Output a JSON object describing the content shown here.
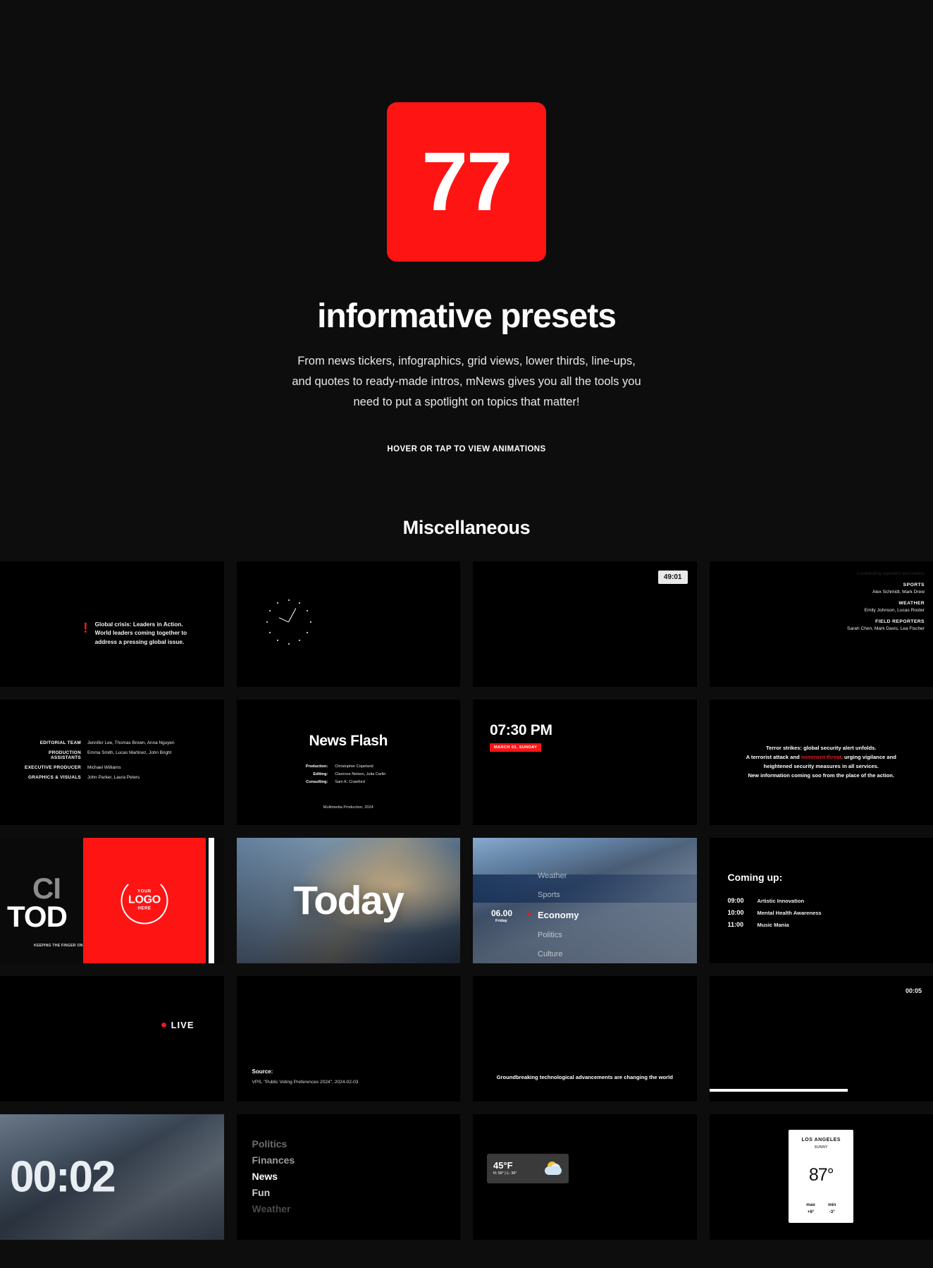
{
  "hero": {
    "badge_number": "77",
    "title": "informative presets",
    "description": "From news tickers, infographics, grid views, lower thirds, line-ups, and quotes to ready-made intros, mNews gives you all the tools you need to put a spotlight on topics that matter!",
    "hint": "HOVER OR TAP TO VIEW ANIMATIONS",
    "accent_color": "#ff1414",
    "background_color": "#0d0d0d"
  },
  "section": {
    "title": "Miscellaneous"
  },
  "tiles": {
    "alert_ticker": {
      "icon": "!",
      "line1": "Global crisis: Leaders in Action.",
      "line2": "World leaders coming together to",
      "line3": "address a pressing global issue."
    },
    "clock": {
      "name": "analog-clock"
    },
    "timer_chip": {
      "value": "49:01"
    },
    "credits_roll": {
      "groups": [
        {
          "role": "SPORTS",
          "names": "Alex Schmidt, Mark Drew"
        },
        {
          "role": "WEATHER",
          "names": "Emily Johnson, Lucas Roster"
        },
        {
          "role": "FIELD REPORTERS",
          "names": "Sarah Chen, Mark Davis, Lea Fischer"
        }
      ]
    },
    "editorial_team": {
      "rows": [
        {
          "role": "EDITORIAL TEAM",
          "names": "Jennifer Lee, Thomas Brown, Anna Nguyen"
        },
        {
          "role": "PRODUCTION ASSISTANTS",
          "names": "Emma Smith, Lucas Martinez, John Bright"
        },
        {
          "role": "EXECUTIVE PRODUCER",
          "names": "Michael Williams"
        },
        {
          "role": "GRAPHICS & VISUALS",
          "names": "John Parker, Laura Peters"
        }
      ]
    },
    "news_flash": {
      "title": "News Flash",
      "rows": [
        {
          "key": "Production:",
          "value": "Christopher Copeland"
        },
        {
          "key": "Editing:",
          "value": "Clarence Nelson, Julia Carlin"
        },
        {
          "key": "Consulting:",
          "value": "Sam K. Crawford"
        }
      ],
      "footer": "Multimedia Production, 2024"
    },
    "time_card": {
      "time": "07:30 PM",
      "date": "MARCH 03, SUNDAY"
    },
    "breaking": {
      "line1": "Terror strikes: global security alert unfolds.",
      "line2a": "A terrorist attack and ",
      "line2b": "imminent threat,",
      "line2c": " urging vigilance and",
      "line3": "heightened security measures in all services.",
      "line4": "New information coming soo from the place of the action."
    },
    "today_logo": {
      "word_top": "CI",
      "word_bottom": "TOD",
      "tagline": "KEEPING THE FINGER ON THE CITY'S PULSE",
      "logo_top": "YOUR",
      "logo_main": "LOGO",
      "logo_bottom": "HERE"
    },
    "today_photo": {
      "word": "Today"
    },
    "city_menu": {
      "time": "06.00",
      "day": "Friday",
      "items": [
        "Weather",
        "Sports",
        "Economy",
        "Politics",
        "Culture"
      ],
      "active": "Economy"
    },
    "coming_up": {
      "title": "Coming up:",
      "rows": [
        {
          "time": "09:00",
          "label": "Artistic Innovation"
        },
        {
          "time": "10:00",
          "label": "Mental Health Awareness"
        },
        {
          "time": "11:00",
          "label": "Music Mania"
        }
      ]
    },
    "live_badge": {
      "label": "LIVE"
    },
    "source": {
      "title": "Source:",
      "text": "VPS, \"Public Voting Preferences 2024\", 2024-02-03"
    },
    "lower_third": {
      "text": "Groundbreaking technological advancements are changing the world"
    },
    "timer_progress": {
      "time": "00:05",
      "progress_percent": 62
    },
    "countdown": {
      "value": "00:02"
    },
    "topics": {
      "items": [
        "Politics",
        "Finances",
        "News",
        "Fun",
        "Weather"
      ]
    },
    "weather_chip": {
      "temp": "45°F",
      "sub": "H: 50° | L: 36°",
      "icon": "sun-behind-cloud-icon"
    },
    "weather_card": {
      "city": "LOS ANGELES",
      "condition": "SUNNY",
      "temp": "87°",
      "max_label": "max",
      "max_value": "+6°",
      "min_label": "min",
      "min_value": "-3°"
    }
  }
}
